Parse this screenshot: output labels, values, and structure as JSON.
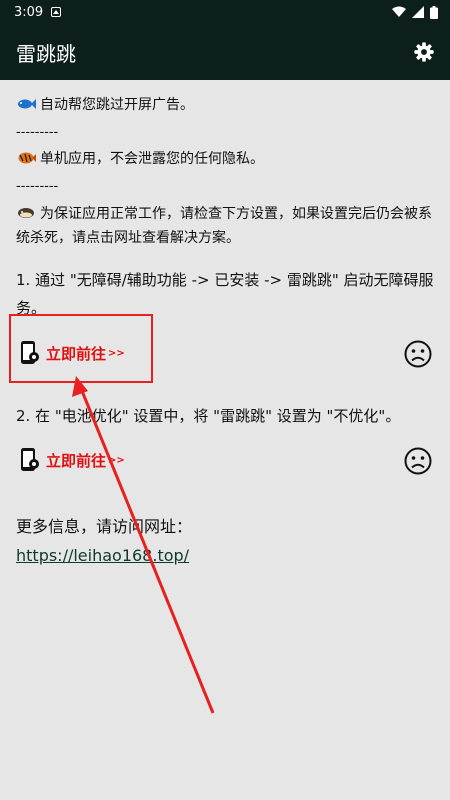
{
  "status_bar": {
    "time": "3:09"
  },
  "app_bar": {
    "title": "雷跳跳"
  },
  "intro": [
    {
      "text": "自动帮您跳过开屏广告。",
      "icon": "fish-blue-icon",
      "color": "#1e6fd0"
    },
    {
      "text": "---------"
    },
    {
      "text": "单机应用，不会泄露您的任何隐私。",
      "icon": "fish-orange-icon",
      "color": "#e0701a"
    },
    {
      "text": "---------"
    },
    {
      "text": "为保证应用正常工作，请检查下方设置，如果设置完后仍会被系统杀死，请点击网址查看解决方案。",
      "icon": "fish-brown-icon",
      "color": "#4a3a2a"
    }
  ],
  "steps": [
    {
      "text": "1. 通过 \"无障碍/辅助功能 -> 已安装 -> 雷跳跳\" 启动无障碍服务。",
      "action": "立即前往",
      "arrow": ">>"
    },
    {
      "text": "2. 在 \"电池优化\" 设置中，将 \"雷跳跳\" 设置为 \"不优化\"。",
      "action": "立即前往",
      "arrow": ">>"
    }
  ],
  "more_info": {
    "label": "更多信息，请访问网址：",
    "url": "https://leihao168.top/"
  },
  "colors": {
    "bar": "#0d1f1b",
    "action": "#e01010",
    "background": "#e6e6e6"
  }
}
